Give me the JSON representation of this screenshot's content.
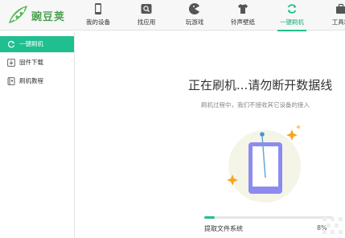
{
  "app": {
    "logo_text": "豌豆荚"
  },
  "nav": {
    "items": [
      {
        "label": "我的设备",
        "icon": "phone-icon"
      },
      {
        "label": "找应用",
        "icon": "find-app-icon"
      },
      {
        "label": "玩游戏",
        "icon": "pacman-icon"
      },
      {
        "label": "铃声壁纸",
        "icon": "shirt-icon"
      },
      {
        "label": "一键刷机",
        "icon": "refresh-icon"
      },
      {
        "label": "工具箱",
        "icon": "toolbox-icon"
      }
    ],
    "active_index": 4
  },
  "sidebar": {
    "items": [
      {
        "label": "一键刷机",
        "icon": "refresh-icon"
      },
      {
        "label": "固件下载",
        "icon": "download-icon"
      },
      {
        "label": "刷机教程",
        "icon": "book-icon"
      }
    ],
    "active_index": 0
  },
  "main": {
    "headline": "正在刷机...请勿断开数据线",
    "subline": "刷机过程中，我们不接收其它设备的接入",
    "progress": {
      "label": "提取文件系统",
      "percent_text": "8%",
      "value": 0.08
    }
  },
  "colors": {
    "accent": "#1fbf8f",
    "phone_body": "#8c8cf0",
    "sparkle": "#f5a623"
  }
}
